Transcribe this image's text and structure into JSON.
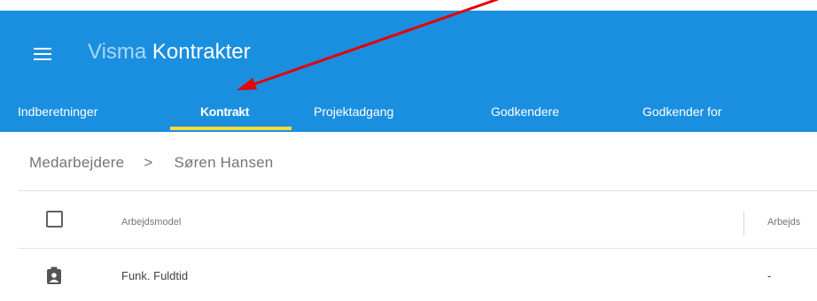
{
  "header": {
    "brand_prefix": "Visma",
    "brand_name": "Kontrakter",
    "background_color": "#1b8fdf",
    "tabs": [
      {
        "label": "Indberetninger"
      },
      {
        "label": "Kontrakt",
        "active": true
      },
      {
        "label": "Projektadgang"
      },
      {
        "label": "Godkendere"
      },
      {
        "label": "Godkender for"
      }
    ],
    "active_tab_underline_color": "#ffd938"
  },
  "breadcrumb": {
    "parent": "Medarbejdere",
    "separator": ">",
    "current": "Søren Hansen"
  },
  "table": {
    "columns": [
      "Arbejdsmodel",
      "Arbejds"
    ],
    "rows": [
      {
        "icon": "clipboard-account-icon",
        "model": "Funk. Fuldtid",
        "second": "-"
      }
    ]
  },
  "annotation": {
    "arrow_color": "#e60000",
    "points_to": "Kontrakt"
  }
}
